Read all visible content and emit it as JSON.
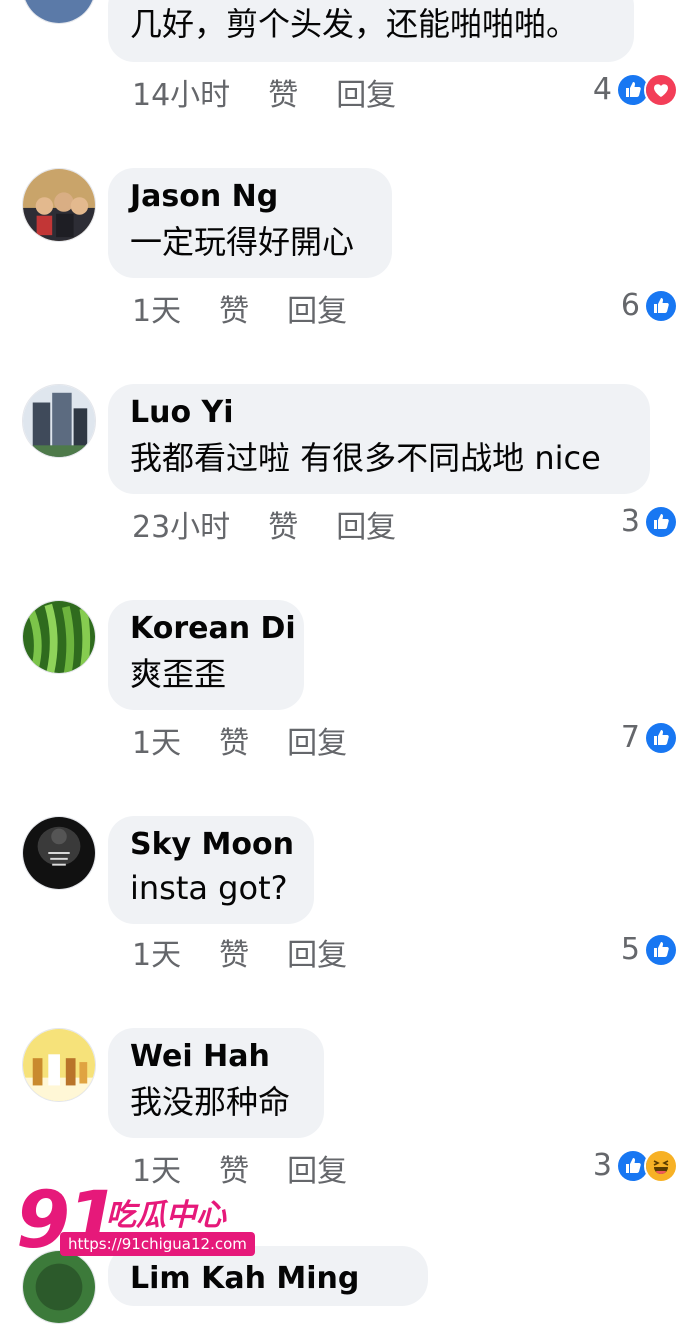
{
  "comments": [
    {
      "author": "",
      "text": "几好，剪个头发，还能啪啪啪。",
      "time": "14小时",
      "like_label": "赞",
      "reply_label": "回复",
      "reaction_count": "4",
      "reactions": [
        "like-icon",
        "love-icon"
      ]
    },
    {
      "author": "Jason Ng",
      "text": "一定玩得好開心",
      "time": "1天",
      "like_label": "赞",
      "reply_label": "回复",
      "reaction_count": "6",
      "reactions": [
        "like-icon"
      ]
    },
    {
      "author": "Luo Yi",
      "text": "我都看过啦 有很多不同战地 nice",
      "time": "23小时",
      "like_label": "赞",
      "reply_label": "回复",
      "reaction_count": "3",
      "reactions": [
        "like-icon"
      ]
    },
    {
      "author": "Korean Di",
      "text": "爽歪歪",
      "time": "1天",
      "like_label": "赞",
      "reply_label": "回复",
      "reaction_count": "7",
      "reactions": [
        "like-icon"
      ]
    },
    {
      "author": "Sky Moon",
      "text": "insta got?",
      "time": "1天",
      "like_label": "赞",
      "reply_label": "回复",
      "reaction_count": "5",
      "reactions": [
        "like-icon"
      ]
    },
    {
      "author": "Wei Hah",
      "text": "我没那种命",
      "time": "1天",
      "like_label": "赞",
      "reply_label": "回复",
      "reaction_count": "3",
      "reactions": [
        "like-icon",
        "haha-icon"
      ]
    },
    {
      "author": "Lim Kah Ming",
      "text": "",
      "time": "",
      "like_label": "",
      "reply_label": "",
      "reaction_count": "",
      "reactions": []
    }
  ],
  "watermark": {
    "logo_number": "91",
    "logo_text": "吃瓜中心",
    "url": "https://91chigua12.com"
  },
  "colors": {
    "bubble": "#f0f2f5",
    "meta_text": "#65676b",
    "like_blue": "#1877f2",
    "love_red": "#f33e58",
    "haha_yellow": "#f7b125",
    "watermark_pink": "#e6197a"
  },
  "avatars": [
    "avatar-photo-blue",
    "avatar-photo-family",
    "avatar-photo-buildings",
    "avatar-photo-green-beans",
    "avatar-never-give-up",
    "avatar-product-photo",
    "avatar-photo-green"
  ]
}
